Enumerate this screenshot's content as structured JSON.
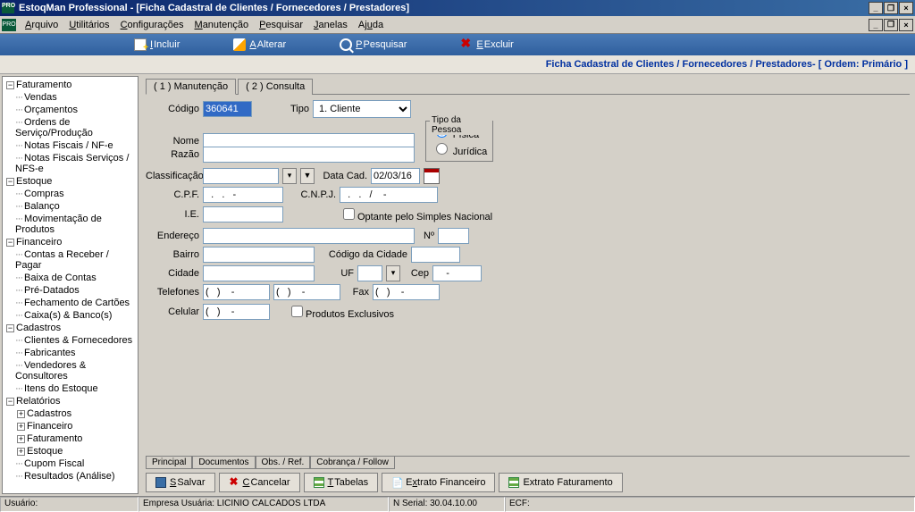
{
  "title": "EstoqMan Professional - [Ficha Cadastral de Clientes / Fornecedores / Prestadores]",
  "menu": [
    "Arquivo",
    "Utilitários",
    "Configurações",
    "Manutenção",
    "Pesquisar",
    "Janelas",
    "Ajuda"
  ],
  "toolbar": {
    "incluir": "Incluir",
    "alterar": "Alterar",
    "pesquisar": "Pesquisar",
    "excluir": "Excluir"
  },
  "banner": "Ficha Cadastral de Clientes / Fornecedores / Prestadores- [ Ordem: Primário ]",
  "tree": [
    {
      "label": "Faturamento",
      "open": true,
      "children": [
        {
          "label": "Vendas"
        },
        {
          "label": "Orçamentos"
        },
        {
          "label": "Ordens de Serviço/Produção"
        },
        {
          "label": "Notas Fiscais / NF-e"
        },
        {
          "label": "Notas Fiscais Serviços / NFS-e"
        }
      ]
    },
    {
      "label": "Estoque",
      "open": true,
      "children": [
        {
          "label": "Compras"
        },
        {
          "label": "Balanço"
        },
        {
          "label": "Movimentação de Produtos"
        }
      ]
    },
    {
      "label": "Financeiro",
      "open": true,
      "children": [
        {
          "label": "Contas a Receber / Pagar"
        },
        {
          "label": "Baixa de Contas"
        },
        {
          "label": "Pré-Datados"
        },
        {
          "label": "Fechamento de Cartões"
        },
        {
          "label": "Caixa(s) & Banco(s)"
        }
      ]
    },
    {
      "label": "Cadastros",
      "open": true,
      "children": [
        {
          "label": "Clientes & Fornecedores"
        },
        {
          "label": "Fabricantes"
        },
        {
          "label": "Vendedores & Consultores"
        },
        {
          "label": "Itens do Estoque"
        }
      ]
    },
    {
      "label": "Relatórios",
      "open": true,
      "children": [
        {
          "label": "Cadastros",
          "expandable": true
        },
        {
          "label": "Financeiro",
          "expandable": true
        },
        {
          "label": "Faturamento",
          "expandable": true
        },
        {
          "label": "Estoque",
          "expandable": true
        },
        {
          "label": "Cupom Fiscal"
        },
        {
          "label": "Resultados (Análise)"
        }
      ]
    }
  ],
  "tabs": {
    "manut": "( 1 ) Manutenção",
    "consulta": "( 2 ) Consulta"
  },
  "labels": {
    "codigo": "Código",
    "tipo": "Tipo",
    "nome": "Nome",
    "razao": "Razão",
    "classif": "Classificação",
    "datacad": "Data Cad.",
    "cpf": "C.P.F.",
    "cnpj": "C.N.P.J.",
    "ie": "I.E.",
    "simples": "Optante pelo Simples Nacional",
    "endereco": "Endereço",
    "num": "Nº",
    "bairro": "Bairro",
    "codcidade": "Código da Cidade",
    "cidade": "Cidade",
    "uf": "UF",
    "cep": "Cep",
    "telefones": "Telefones",
    "fax": "Fax",
    "celular": "Celular",
    "prodexcl": "Produtos Exclusivos",
    "tipopessoa": "Tipo da Pessoa",
    "fisica": "Física",
    "juridica": "Jurídica"
  },
  "values": {
    "codigo": "360641",
    "tipo_sel": "1. Cliente",
    "datacad": "02/03/16",
    "cpf": "  .   .   -",
    "cnpj": "  .   .   /    -",
    "tel1": "(   )    -",
    "tel2": "(   )    -",
    "fax": "(   )    -",
    "cel": "(   )    -",
    "cep": "    -"
  },
  "bottom_tabs": [
    "Principal",
    "Documentos",
    "Obs. / Ref.",
    "Cobrança / Follow"
  ],
  "buttons": {
    "salvar": "Salvar",
    "cancelar": "Cancelar",
    "tabelas": "Tabelas",
    "extfin": "Extrato Financeiro",
    "extfat": "Extrato Faturamento"
  },
  "status": {
    "usuario_lbl": "Usuário:",
    "empresa": "Empresa Usuária: LICINIO CALCADOS LTDA",
    "serial": "N Serial: 30.04.10.00",
    "ecf": "ECF:"
  }
}
